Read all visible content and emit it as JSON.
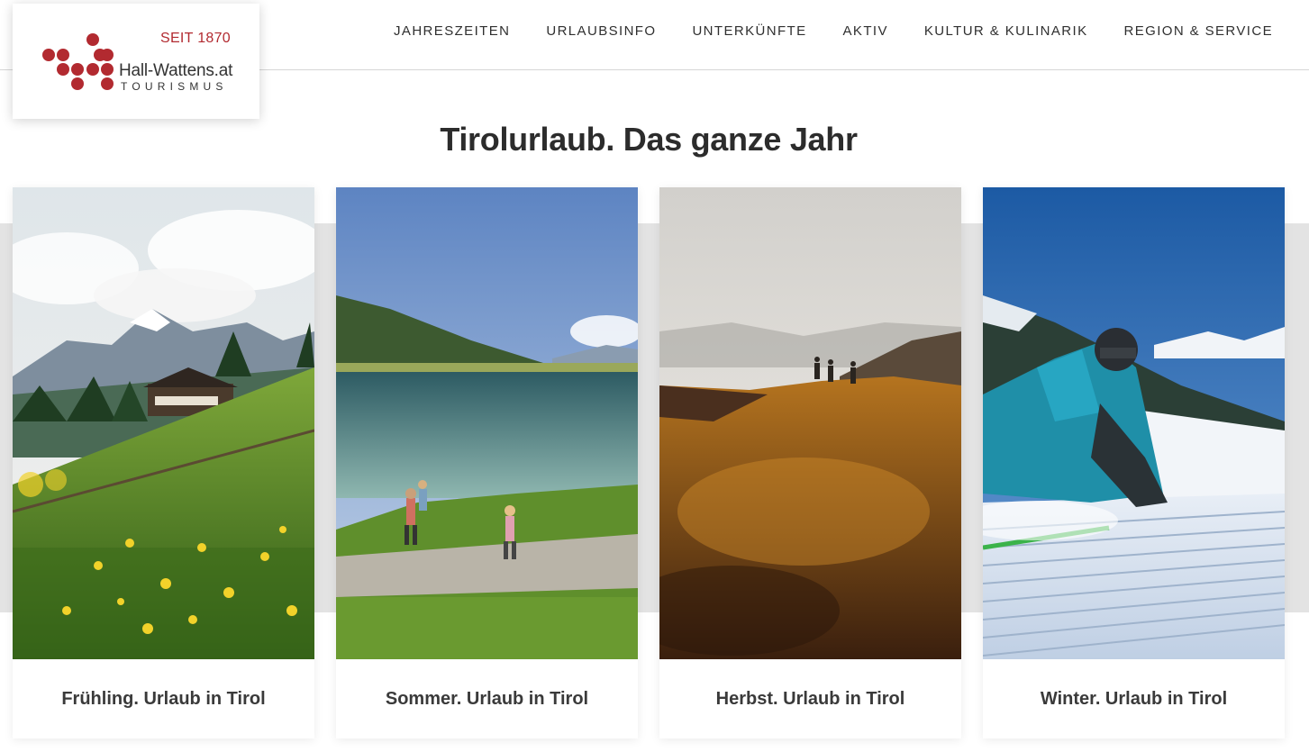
{
  "logo": {
    "since": "SEIT 1870",
    "name": "Hall-Wattens.at",
    "sub": "TOURISMUS",
    "brand_color": "#b22a30"
  },
  "nav": {
    "items": [
      {
        "label": "JAHRESZEITEN"
      },
      {
        "label": "URLAUBSINFO"
      },
      {
        "label": "UNTERKÜNFTE"
      },
      {
        "label": "AKTIV"
      },
      {
        "label": "KULTUR & KULINARIK"
      },
      {
        "label": "REGION & SERVICE"
      }
    ]
  },
  "headline": {
    "bold": "Tirolurlaub.",
    "rest": " Das ganze Jahr"
  },
  "cards": [
    {
      "caption": "Frühling. Urlaub in Tirol",
      "image": "spring-meadow-photo"
    },
    {
      "caption": "Sommer. Urlaub in Tirol",
      "image": "summer-lake-hikers-photo"
    },
    {
      "caption": "Herbst. Urlaub in Tirol",
      "image": "autumn-ridge-hikers-photo"
    },
    {
      "caption": "Winter. Urlaub in Tirol",
      "image": "winter-skier-photo"
    }
  ]
}
